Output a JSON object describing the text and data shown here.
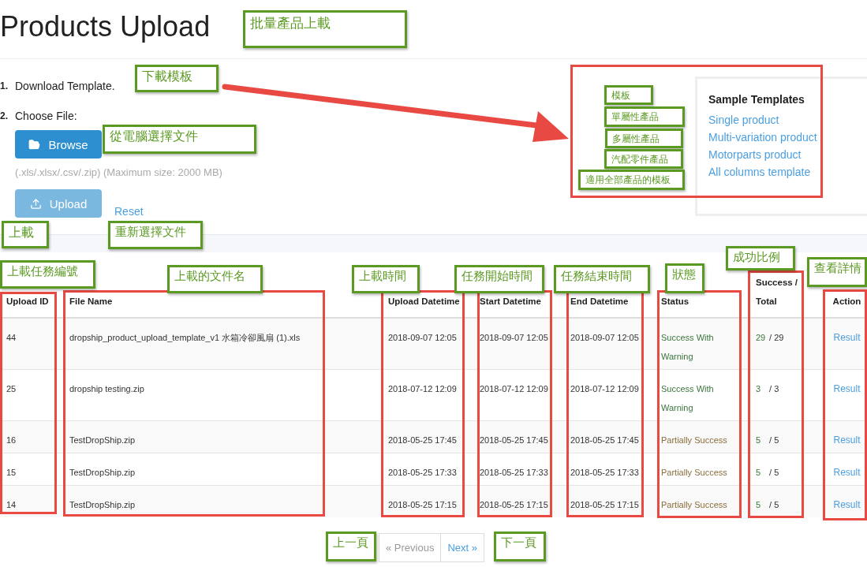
{
  "title": "Products Upload",
  "upload_form": {
    "steps": [
      {
        "number": "1.",
        "label": "Download Template."
      },
      {
        "number": "2.",
        "label": "Choose File:"
      }
    ],
    "browse_button": "Browse",
    "hint": "(.xls/.xlsx/.csv/.zip) (Maximum size: 2000 MB)",
    "upload_button": {
      "label": "Upload",
      "disabled": true
    },
    "reset_link": "Reset"
  },
  "sample_templates": {
    "title": "Sample Templates",
    "links": [
      "Single product",
      "Multi-variation product",
      "Motorparts product",
      "All columns template"
    ]
  },
  "table": {
    "columns": [
      "Upload ID",
      "File Name",
      "Upload Datetime",
      "Start Datetime",
      "End Datetime",
      "Status",
      "Success / Total",
      "Action"
    ],
    "rows": [
      {
        "id": "44",
        "file_name": "dropship_product_upload_template_v1 水箱冷卻風扇 (1).xls",
        "upload": "2018-09-07 12:05",
        "start": "2018-09-07 12:05",
        "end": "2018-09-07 12:05",
        "status": {
          "text": "Success With Warning",
          "kind": "warning"
        },
        "success": "29",
        "separator": "/",
        "total": "29",
        "action": "Result"
      },
      {
        "id": "25",
        "file_name": "dropship testing.zip",
        "upload": "2018-07-12 12:09",
        "start": "2018-07-12 12:09",
        "end": "2018-07-12 12:09",
        "status": {
          "text": "Success With Warning",
          "kind": "warning"
        },
        "success": "3",
        "separator": "/",
        "total": "3",
        "action": "Result"
      },
      {
        "id": "16",
        "file_name": "TestDropShip.zip",
        "upload": "2018-05-25 17:45",
        "start": "2018-05-25 17:45",
        "end": "2018-05-25 17:45",
        "status": {
          "text": "Partially Success",
          "kind": "partial"
        },
        "success": "5",
        "separator": "/",
        "total": "5",
        "action": "Result"
      },
      {
        "id": "15",
        "file_name": "TestDropShip.zip",
        "upload": "2018-05-25 17:33",
        "start": "2018-05-25 17:33",
        "end": "2018-05-25 17:33",
        "status": {
          "text": "Partially Success",
          "kind": "partial"
        },
        "success": "5",
        "separator": "/",
        "total": "5",
        "action": "Result"
      },
      {
        "id": "14",
        "file_name": "TestDropShip.zip",
        "upload": "2018-05-25 17:15",
        "start": "2018-05-25 17:15",
        "end": "2018-05-25 17:15",
        "status": {
          "text": "Partially Success",
          "kind": "partial"
        },
        "success": "5",
        "separator": "/",
        "total": "5",
        "action": "Result"
      }
    ]
  },
  "pagination": {
    "previous": {
      "label": "« Previous",
      "disabled": true
    },
    "next": {
      "label": "Next »",
      "disabled": false
    }
  },
  "annotations": [
    "批量產品上載",
    "下載模板",
    "從電腦選擇文件",
    "上載",
    "重新選擇文件",
    "模板",
    "單屬性產品",
    "多屬性產品",
    "汽配零件產品",
    "適用全部產品的模板",
    "上載任務編號",
    "上載的文件名",
    "上載時間",
    "任務開始時間",
    "任務結束時間",
    "狀態",
    "成功比例",
    "查看詳情",
    "上一頁",
    "下一頁"
  ]
}
